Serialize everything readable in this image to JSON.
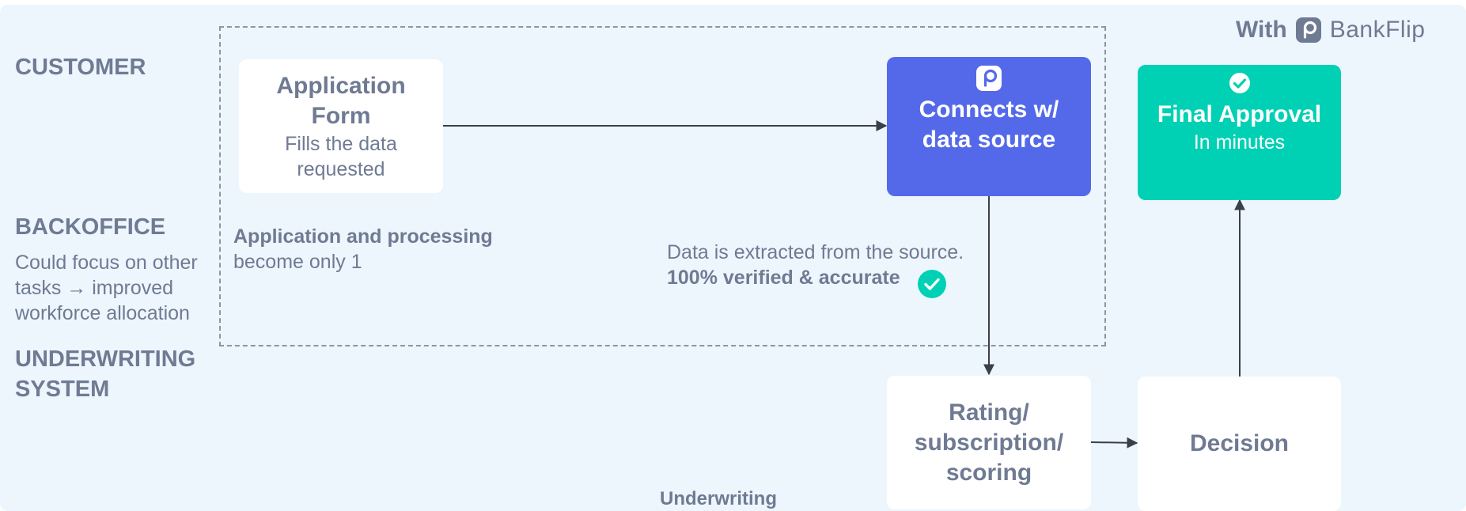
{
  "lanes": {
    "customer": "CUSTOMER",
    "backoffice": "BACKOFFICE",
    "backoffice_note": "Could focus on other tasks → improved workforce allocation",
    "underwriting_line1": "UNDERWRITING",
    "underwriting_line2": "SYSTEM"
  },
  "brand": {
    "prefix": "With",
    "name": "BankFlip",
    "icon": "bankflip-logo-icon"
  },
  "nodes": {
    "application_form": {
      "title_line1": "Application",
      "title_line2": "Form",
      "sub_line1": "Fills the data",
      "sub_line2": "requested"
    },
    "connects": {
      "icon": "bankflip-logo-icon",
      "title_line1": "Connects w/",
      "title_line2": "data source"
    },
    "final_approval": {
      "icon": "check-circle-icon",
      "title": "Final Approval",
      "sub": "In minutes"
    },
    "rating": {
      "title_line1": "Rating/",
      "title_line2": "subscription/",
      "title_line3": "scoring"
    },
    "decision": {
      "title": "Decision"
    }
  },
  "notes": {
    "application_processing_bold": "Application and processing",
    "application_processing_rest": "become only 1",
    "extraction_line1": "Data is extracted from the source.",
    "extraction_bold": "100% verified & accurate",
    "extraction_icon": "check-circle-icon",
    "underwriting_label": "Underwriting"
  },
  "colors": {
    "background": "#edf6fd",
    "text_gray": "#6f7a93",
    "connect_blue": "#5469ea",
    "approval_teal": "#00d0b4",
    "arrow": "#3b3f4a"
  }
}
